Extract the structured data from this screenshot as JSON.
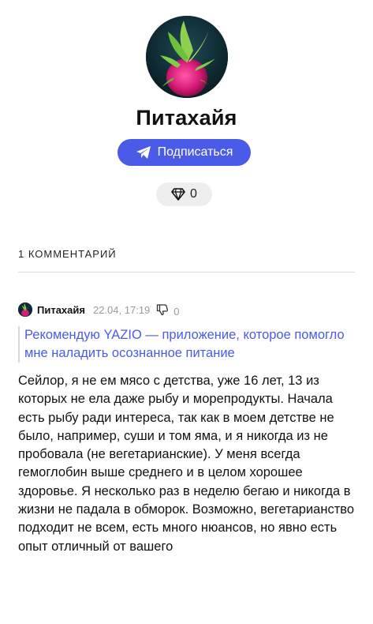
{
  "profile": {
    "name": "Питахайя",
    "subscribe_label": "Подписаться",
    "karma": "0"
  },
  "comments": {
    "count_label": "1 КОММЕНТАРИЙ",
    "items": [
      {
        "author": "Питахайя",
        "date": "22.04, 17:19",
        "votes": "0",
        "quote": "Рекомендую YAZIO — приложение, которое помогло мне наладить осознанное питание",
        "text": "Сейлор, я не ем мясо с детства, уже 16 лет, 13 из которых не ела даже рыбу и морепродукты. Начала есть рыбу ради интереса, так как в моем детстве не было, например, суши и том яма, и я никогда из не пробовала (не вегетарианские). У меня всегда гемоглобин выше среднего и в целом хорошее здоровье. Я несколько раз в неделю бегаю и никогда в жизни не падала в обморок. Возможно, вегетарианство подходит не всем, есть много нюансов, но явно есть опыт отличный от вашего"
      }
    ]
  },
  "icons": {
    "subscribe": "telegram-paper-plane-icon",
    "karma": "diamond-icon",
    "dislike": "thumbs-down-icon"
  },
  "colors": {
    "accent": "#4a5be8",
    "muted": "#9a9a9a",
    "karma_bg": "#eeeeee"
  }
}
